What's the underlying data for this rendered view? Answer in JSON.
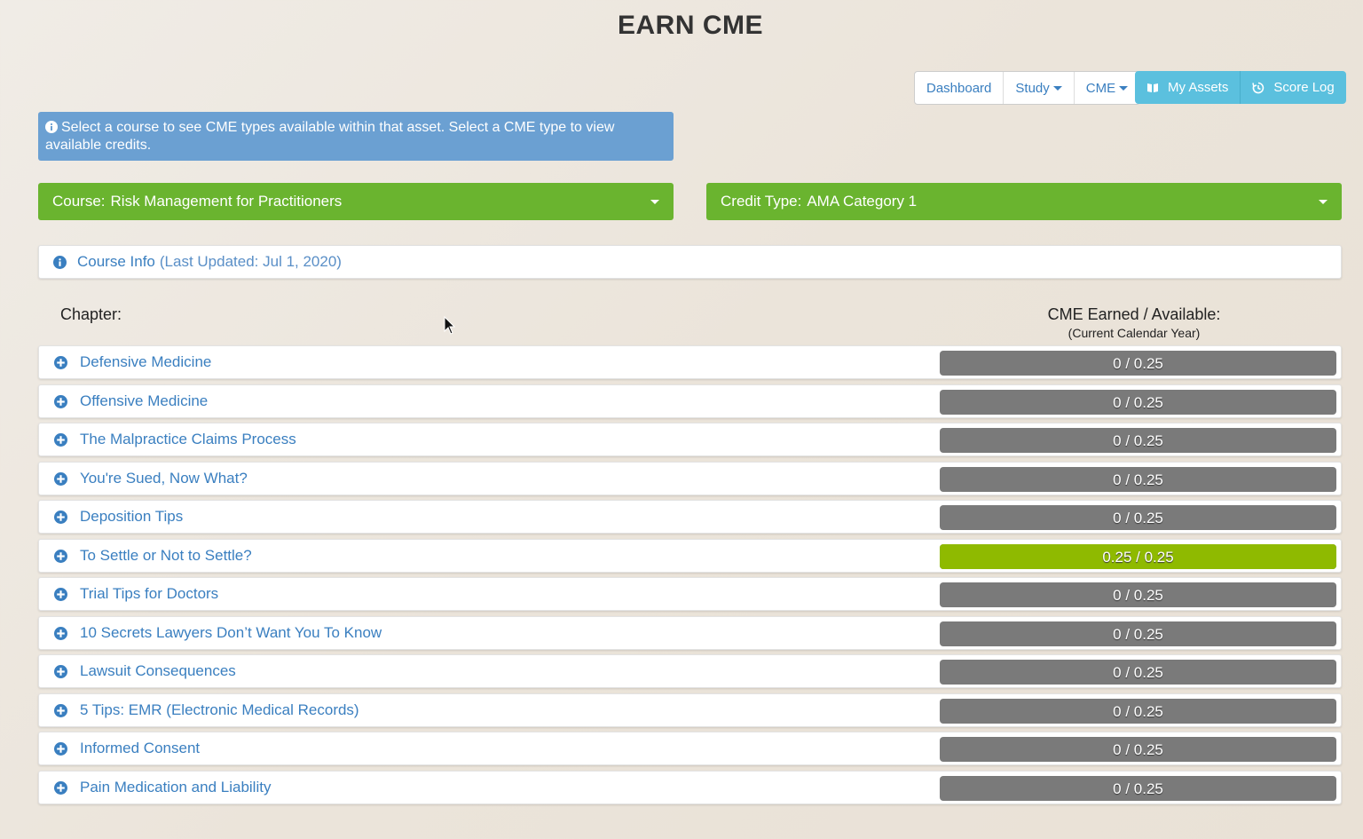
{
  "page": {
    "title": "EARN CME"
  },
  "nav": {
    "dashboard": "Dashboard",
    "study": "Study",
    "cme": "CME",
    "my_assets": "My Assets",
    "score_log": "Score Log"
  },
  "info_message": "Select a course to see CME types available within that asset. Select a CME type to view available credits.",
  "course_select": {
    "label": "Course:",
    "value": "Risk Management for Practitioners"
  },
  "credit_select": {
    "label": "Credit Type:",
    "value": "AMA Category 1"
  },
  "course_info": {
    "link": "Course Info",
    "updated": "(Last Updated: Jul 1, 2020)"
  },
  "table": {
    "chapter_header": "Chapter:",
    "earned_header": "CME Earned / Available:",
    "earned_subheader": "(Current Calendar Year)"
  },
  "colors": {
    "accent": "#3a7fc0",
    "green": "#6ab42f",
    "progress_bg": "#7a7a7a",
    "progress_fill": "#8fba00",
    "info": "#6ba0d2",
    "asset_btn": "#5bc0de"
  },
  "chapters": [
    {
      "title": "Defensive Medicine",
      "earned": "0",
      "available": "0.25",
      "display": "0 / 0.25",
      "fraction": 0
    },
    {
      "title": "Offensive Medicine",
      "earned": "0",
      "available": "0.25",
      "display": "0 / 0.25",
      "fraction": 0
    },
    {
      "title": "The Malpractice Claims Process",
      "earned": "0",
      "available": "0.25",
      "display": "0 / 0.25",
      "fraction": 0
    },
    {
      "title": "You're Sued, Now What?",
      "earned": "0",
      "available": "0.25",
      "display": "0 / 0.25",
      "fraction": 0
    },
    {
      "title": "Deposition Tips",
      "earned": "0",
      "available": "0.25",
      "display": "0 / 0.25",
      "fraction": 0
    },
    {
      "title": "To Settle or Not to Settle?",
      "earned": "0.25",
      "available": "0.25",
      "display": "0.25 / 0.25",
      "fraction": 1
    },
    {
      "title": "Trial Tips for Doctors",
      "earned": "0",
      "available": "0.25",
      "display": "0 / 0.25",
      "fraction": 0
    },
    {
      "title": "10 Secrets Lawyers Don’t Want You To Know",
      "earned": "0",
      "available": "0.25",
      "display": "0 / 0.25",
      "fraction": 0
    },
    {
      "title": "Lawsuit Consequences",
      "earned": "0",
      "available": "0.25",
      "display": "0 / 0.25",
      "fraction": 0
    },
    {
      "title": "5 Tips: EMR (Electronic Medical Records)",
      "earned": "0",
      "available": "0.25",
      "display": "0 / 0.25",
      "fraction": 0
    },
    {
      "title": "Informed Consent",
      "earned": "0",
      "available": "0.25",
      "display": "0 / 0.25",
      "fraction": 0
    },
    {
      "title": "Pain Medication and Liability",
      "earned": "0",
      "available": "0.25",
      "display": "0 / 0.25",
      "fraction": 0
    }
  ]
}
